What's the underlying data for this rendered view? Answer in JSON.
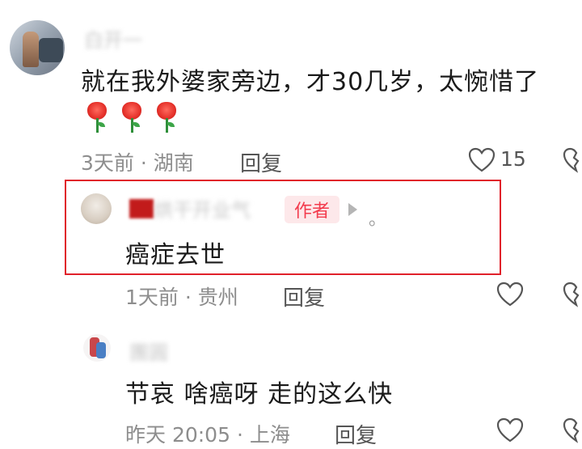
{
  "comments": [
    {
      "name": "白开一",
      "content": "就在我外婆家旁边，才30几岁，太惋惜了",
      "emoji": [
        "rose",
        "rose",
        "rose"
      ],
      "time": "3天前",
      "location": "湖南",
      "reply_label": "回复",
      "likes": "15"
    },
    {
      "name": "烘干开业气",
      "author_badge": "作者",
      "content": "癌症去世",
      "time": "1天前",
      "location": "贵州",
      "reply_label": "回复"
    },
    {
      "name": "團圓",
      "content": "节哀 啥癌呀 走的这么快",
      "time": "昨天 20:05",
      "location": "上海",
      "reply_label": "回复"
    }
  ],
  "separator": "·",
  "trailing_mark": "。",
  "colors": {
    "highlight_box": "#e0202a",
    "author_badge_bg": "#fde8ea",
    "author_badge_text": "#f33b4d",
    "meta_text": "#8d8d8d"
  },
  "icons": [
    "heart-outline-icon",
    "dislike-broken-heart-icon",
    "rose-emoji",
    "triangle-arrow-icon"
  ]
}
